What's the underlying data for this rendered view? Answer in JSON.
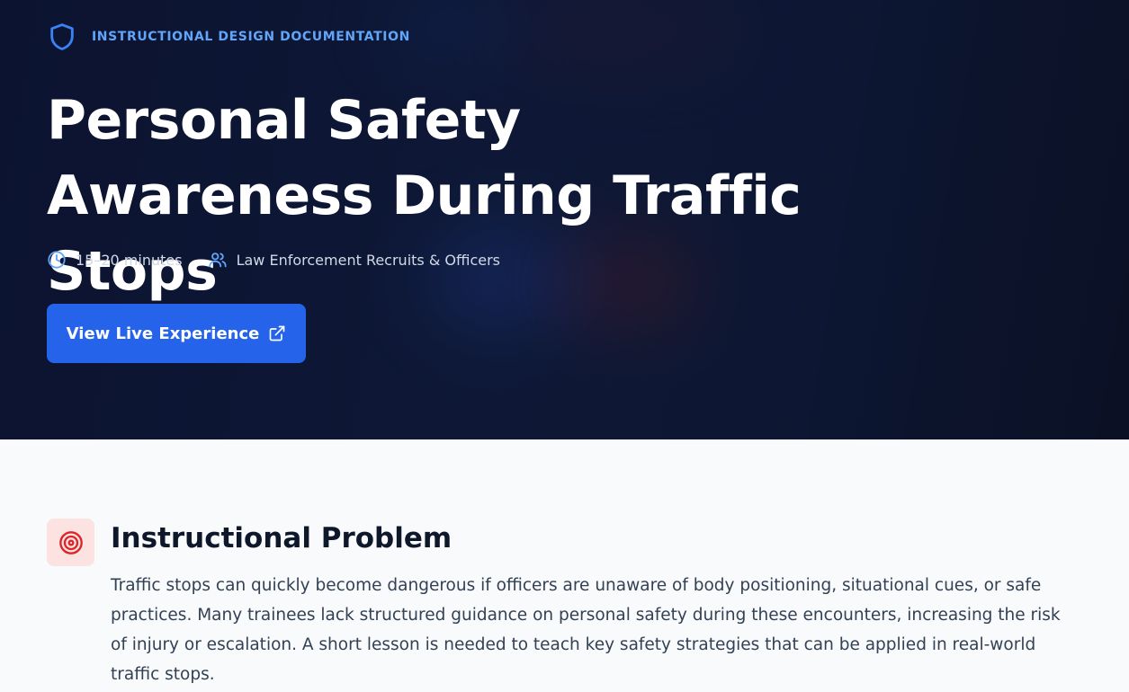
{
  "hero": {
    "eyebrow": "INSTRUCTIONAL DESIGN DOCUMENTATION",
    "eyebrow_icon": "shield-icon",
    "title": "Personal Safety Awareness During Traffic Stops",
    "meta": {
      "duration": "15–20 minutes",
      "duration_icon": "clock-icon",
      "audience": "Law Enforcement Recruits & Officers",
      "audience_icon": "users-icon"
    },
    "cta": {
      "label": "View Live Experience",
      "icon": "external-link-icon"
    }
  },
  "problem": {
    "icon": "target-icon",
    "title": "Instructional Problem",
    "body": "Traffic stops can quickly become dangerous if officers are unaware of body positioning, situational cues, or safe practices. Many trainees lack structured guidance on personal safety during these encounters, increasing the risk of injury or escalation. A short lesson is needed to teach key safety strategies that can be applied in real-world traffic stops."
  },
  "colors": {
    "accent": "#2563eb",
    "eyebrow": "#60a5fa",
    "hero_bg": "#0e1836",
    "target_red": "#dc2626",
    "icon_bg": "#fde2e2"
  }
}
